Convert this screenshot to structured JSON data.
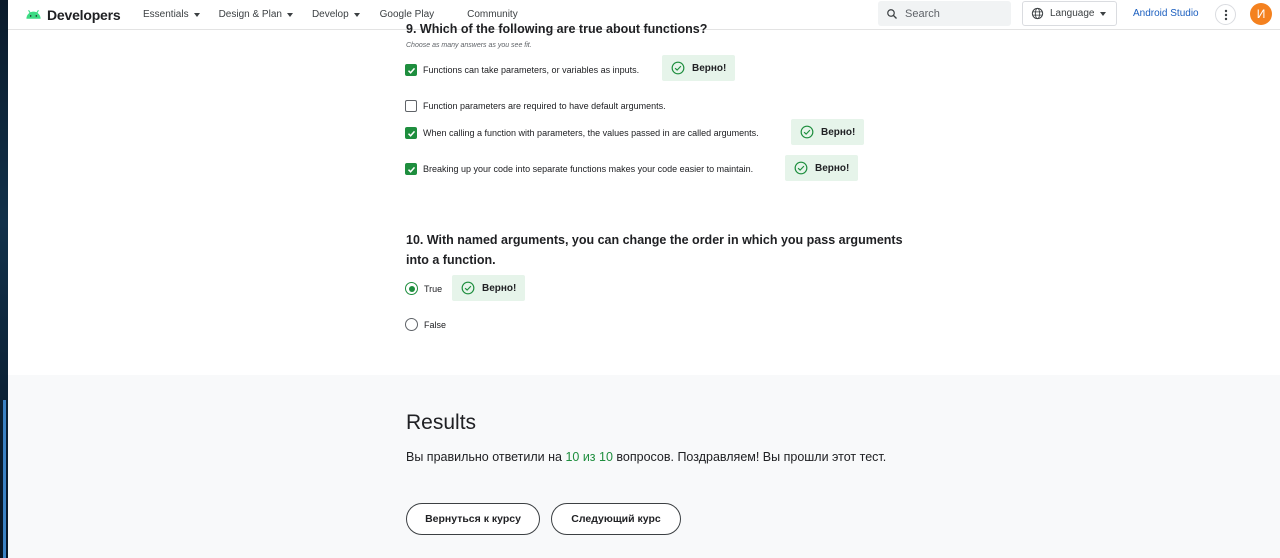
{
  "header": {
    "logo_text": "Developers",
    "nav": [
      {
        "label": "Essentials",
        "dropdown": true
      },
      {
        "label": "Design & Plan",
        "dropdown": true
      },
      {
        "label": "Develop",
        "dropdown": true
      },
      {
        "label": "Google Play",
        "dropdown": false
      },
      {
        "label": "Community",
        "dropdown": false
      }
    ],
    "search_placeholder": "Search",
    "language_label": "Language",
    "android_studio_label": "Android Studio",
    "avatar_initial": "И"
  },
  "question9": {
    "title": "9. Which of the following are true about functions?",
    "subtitle": "Choose as many answers as you see fit.",
    "options": [
      {
        "label": "Functions can take parameters, or variables as inputs.",
        "checked": true,
        "feedback": "Верно!"
      },
      {
        "label": "Function parameters are required to have default arguments.",
        "checked": false,
        "feedback": ""
      },
      {
        "label": "When calling a function with parameters, the values passed in are called arguments.",
        "checked": true,
        "feedback": "Верно!"
      },
      {
        "label": "Breaking up your code into separate functions makes your code easier to maintain.",
        "checked": true,
        "feedback": "Верно!"
      }
    ]
  },
  "question10": {
    "title": "10. With named arguments, you can change the order in which you pass arguments into a function.",
    "options": [
      {
        "label": "True",
        "selected": true,
        "feedback": "Верно!"
      },
      {
        "label": "False",
        "selected": false,
        "feedback": ""
      }
    ]
  },
  "results": {
    "title": "Results",
    "text_before": "Вы правильно ответили на ",
    "score": "10 из 10",
    "text_after": " вопросов. Поздравляем! Вы прошли этот тест.",
    "back_button": "Вернуться к курсу",
    "next_button": "Следующий курс"
  },
  "colors": {
    "accent_green": "#1e8e3e",
    "badge_bg": "#e6f4ea",
    "link_blue": "#1a5ebf",
    "avatar_orange": "#f4811f"
  }
}
